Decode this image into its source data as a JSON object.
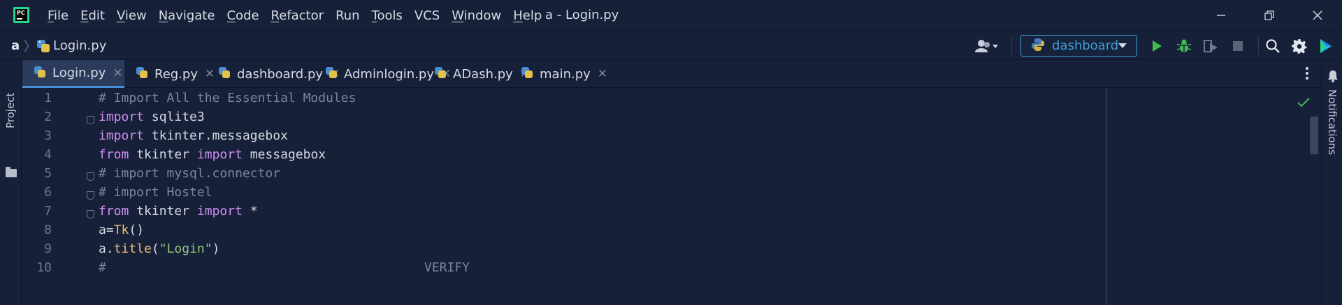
{
  "titlebar": {
    "app_logo_text": "PC",
    "menu": [
      {
        "label": "File",
        "mnemonic": "F",
        "rest": "ile"
      },
      {
        "label": "Edit",
        "mnemonic": "E",
        "rest": "dit"
      },
      {
        "label": "View",
        "mnemonic": "V",
        "rest": "iew"
      },
      {
        "label": "Navigate",
        "mnemonic": "N",
        "rest": "avigate"
      },
      {
        "label": "Code",
        "mnemonic": "C",
        "rest": "ode"
      },
      {
        "label": "Refactor",
        "mnemonic": "R",
        "rest": "efactor"
      },
      {
        "label": "Run",
        "mnemonic": "",
        "rest": "Run"
      },
      {
        "label": "Tools",
        "mnemonic": "T",
        "rest": "ools"
      },
      {
        "label": "VCS",
        "mnemonic": "",
        "rest": "VCS"
      },
      {
        "label": "Window",
        "mnemonic": "W",
        "rest": "indow"
      },
      {
        "label": "Help",
        "mnemonic": "H",
        "rest": "elp"
      }
    ],
    "window_title": "a - Login.py"
  },
  "navbar": {
    "project": "a",
    "file": "Login.py",
    "run_config": "dashboard"
  },
  "left_strip": {
    "label": "Project"
  },
  "right_strip": {
    "label": "Notifications"
  },
  "tabs": [
    {
      "label": "Login.py",
      "active": true
    },
    {
      "label": "Reg.py",
      "active": false
    },
    {
      "label": "dashboard.py",
      "active": false
    },
    {
      "label": "Adminlogin.py",
      "active": false
    },
    {
      "label": "ADash.py",
      "active": false
    },
    {
      "label": "main.py",
      "active": false
    }
  ],
  "editor": {
    "line_numbers": [
      "1",
      "2",
      "3",
      "4",
      "5",
      "6",
      "7",
      "8",
      "9",
      "10"
    ],
    "lines": [
      [
        {
          "t": "# Import All the Essential Modules",
          "c": "cm"
        }
      ],
      [
        {
          "t": "import",
          "c": "kw"
        },
        {
          "t": " sqlite3",
          "c": ""
        }
      ],
      [
        {
          "t": "import",
          "c": "kw"
        },
        {
          "t": " tkinter.messagebox",
          "c": ""
        }
      ],
      [
        {
          "t": "from",
          "c": "kw"
        },
        {
          "t": " tkinter ",
          "c": ""
        },
        {
          "t": "import",
          "c": "kw"
        },
        {
          "t": " messagebox",
          "c": ""
        }
      ],
      [
        {
          "t": "# import mysql.connector",
          "c": "cm"
        }
      ],
      [
        {
          "t": "# import Hostel",
          "c": "cm"
        }
      ],
      [
        {
          "t": "from",
          "c": "kw"
        },
        {
          "t": " tkinter ",
          "c": ""
        },
        {
          "t": "import",
          "c": "kw"
        },
        {
          "t": " *",
          "c": ""
        }
      ],
      [
        {
          "t": "a=",
          "c": ""
        },
        {
          "t": "Tk",
          "c": "fn"
        },
        {
          "t": "()",
          "c": ""
        }
      ],
      [
        {
          "t": "a.",
          "c": ""
        },
        {
          "t": "title",
          "c": "fn"
        },
        {
          "t": "(",
          "c": ""
        },
        {
          "t": "\"Login\"",
          "c": "st"
        },
        {
          "t": ")",
          "c": ""
        }
      ],
      [
        {
          "t": "#",
          "c": "cm"
        },
        {
          "t": "                                          VERIFY ",
          "c": "cm"
        }
      ]
    ]
  },
  "colors": {
    "background": "#172039",
    "accent": "#3e9ed4",
    "run_green": "#3fb950",
    "keyword": "#cf8ef0",
    "comment": "#7c8598",
    "function": "#e7bd74",
    "string": "#8fc87a"
  }
}
